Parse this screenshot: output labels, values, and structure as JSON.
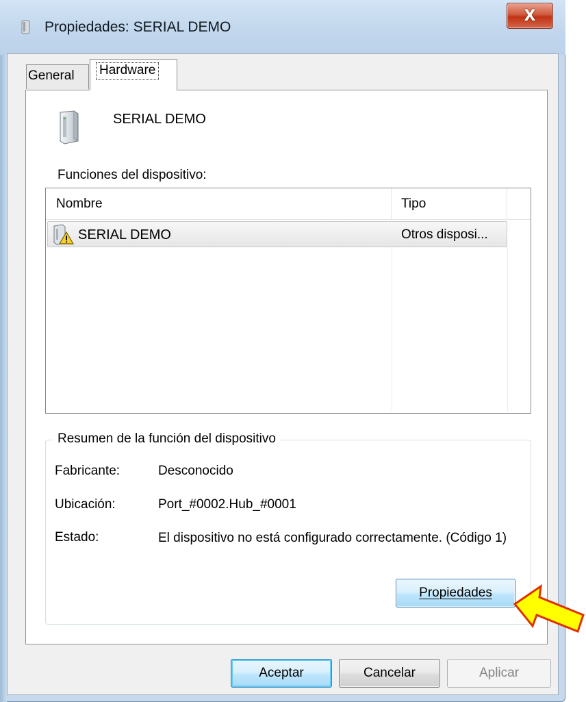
{
  "window": {
    "title": "Propiedades: SERIAL DEMO",
    "close_glyph": "X",
    "title_icon": "device-icon",
    "close_icon": "close-icon"
  },
  "tabs": [
    {
      "label": "General",
      "selected": false
    },
    {
      "label": "Hardware",
      "selected": true
    }
  ],
  "device": {
    "name": "SERIAL DEMO",
    "icon": "device-tower-icon"
  },
  "functions": {
    "label": "Funciones del dispositivo:",
    "columns": [
      "Nombre",
      "Tipo"
    ],
    "rows": [
      {
        "name": "SERIAL DEMO",
        "type": "Otros disposi...",
        "icon": "device-warning-icon",
        "selected": true
      }
    ]
  },
  "summary": {
    "title": "Resumen de la función del dispositivo",
    "manufacturer_label": "Fabricante:",
    "manufacturer_value": "Desconocido",
    "location_label": "Ubicación:",
    "location_value": "Port_#0002.Hub_#0001",
    "status_label": "Estado:",
    "status_value": "El dispositivo no está configurado correctamente. (Código 1)",
    "properties_button": "Propiedades"
  },
  "buttons": {
    "ok": "Aceptar",
    "cancel": "Cancelar",
    "apply": "Aplicar"
  },
  "annotation": {
    "arrow_color": "#ffff00",
    "arrow_outline": "#e03000"
  },
  "colors": {
    "frame": "#c6d9ec",
    "client": "#f0f0f0",
    "button_focus": "#3c7fb1"
  }
}
